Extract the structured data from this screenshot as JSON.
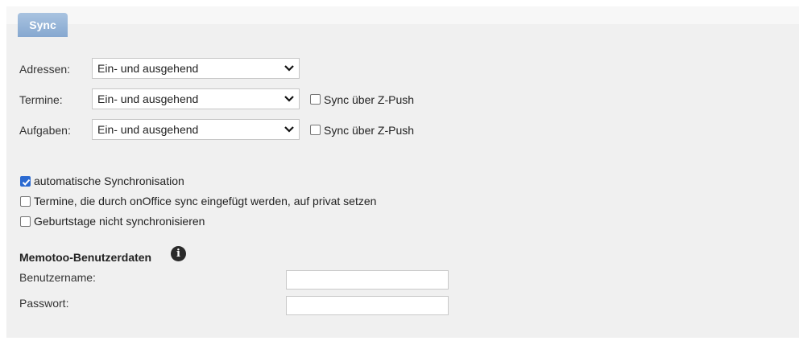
{
  "tab": {
    "label": "Sync"
  },
  "rows": [
    {
      "label": "Adressen:",
      "value": "Ein- und ausgehend"
    },
    {
      "label": "Termine:",
      "value": "Ein- und ausgehend",
      "checkbox_label": "Sync über Z-Push",
      "checked": false
    },
    {
      "label": "Aufgaben:",
      "value": "Ein- und ausgehend",
      "checkbox_label": "Sync über Z-Push",
      "checked": false
    }
  ],
  "options": [
    {
      "label": "automatische Synchronisation",
      "checked": true
    },
    {
      "label": "Termine, die durch onOffice sync eingefügt werden, auf privat setzen",
      "checked": false
    },
    {
      "label": "Geburtstage nicht synchronisieren",
      "checked": false
    }
  ],
  "memotoo": {
    "title": "Memotoo-Benutzerdaten",
    "info_icon": "info-icon",
    "username_label": "Benutzername:",
    "username_value": "",
    "password_label": "Passwort:",
    "password_value": ""
  },
  "colors": {
    "tab": "#92b1d6",
    "panel": "#f0f0f0",
    "checkbox_checked": "#2b6ad1"
  }
}
